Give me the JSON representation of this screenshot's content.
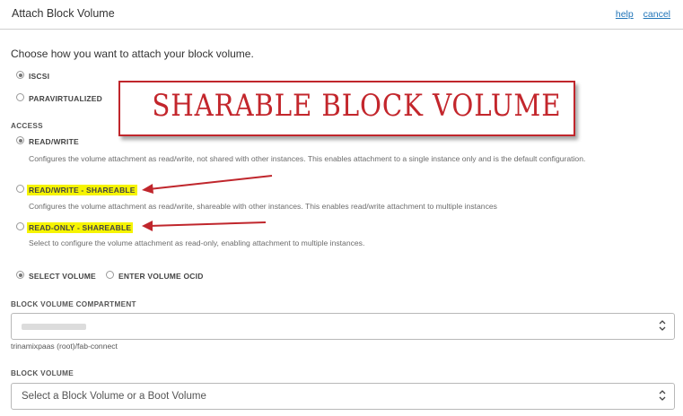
{
  "header": {
    "title": "Attach Block Volume",
    "help": "help",
    "cancel": "cancel"
  },
  "intro": "Choose how you want to attach your block volume.",
  "attach_types": [
    {
      "label": "ISCSI",
      "selected": true
    },
    {
      "label": "PARAVIRTUALIZED",
      "selected": false
    }
  ],
  "access": {
    "heading": "ACCESS",
    "options": [
      {
        "label": "READ/WRITE",
        "selected": true,
        "desc": "Configures the volume attachment as read/write, not shared with other instances. This enables attachment to a single instance only and is the default configuration."
      },
      {
        "label": "READ/WRITE - SHAREABLE",
        "selected": false,
        "desc": "Configures the volume attachment as read/write, shareable with other instances. This enables read/write attachment to multiple instances"
      },
      {
        "label": "READ-ONLY - SHAREABLE",
        "selected": false,
        "desc": "Select to configure the volume attachment as read-only, enabling attachment to multiple instances."
      }
    ]
  },
  "volume_select": [
    {
      "label": "SELECT VOLUME",
      "selected": true
    },
    {
      "label": "ENTER VOLUME OCID",
      "selected": false
    }
  ],
  "compartment": {
    "heading": "BLOCK VOLUME COMPARTMENT",
    "path": "trinamixpaas (root)/fab-connect"
  },
  "block_volume": {
    "heading": "BLOCK VOLUME",
    "placeholder": "Select a Block Volume or a Boot Volume"
  },
  "callout": {
    "text": "SHARABLE BLOCK VOLUME",
    "color": "#c3262c"
  },
  "colors": {
    "highlight": "#f6f400",
    "link": "#1f74b8",
    "arrow": "#c0262c"
  }
}
